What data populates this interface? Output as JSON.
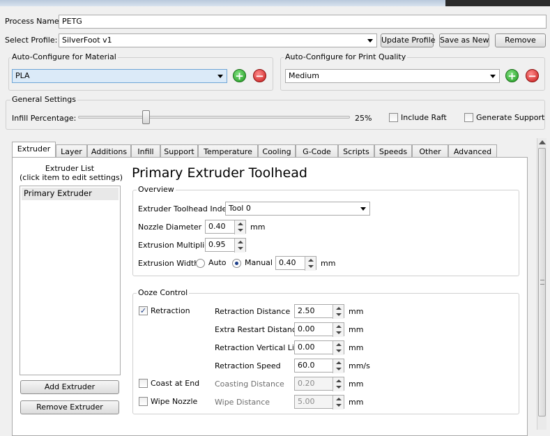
{
  "window": {
    "title": ""
  },
  "process": {
    "name_label": "Process Name:",
    "name_value": "PETG"
  },
  "profile": {
    "label": "Select Profile:",
    "selected": "SilverFoot v1",
    "update_button": "Update Profile",
    "save_as_new_button": "Save as New",
    "remove_button": "Remove"
  },
  "material": {
    "group_label": "Auto-Configure for Material",
    "selected": "PLA",
    "add_symbol": "+",
    "remove_symbol": "−"
  },
  "quality": {
    "group_label": "Auto-Configure for Print Quality",
    "selected": "Medium",
    "add_symbol": "+",
    "remove_symbol": "−"
  },
  "general": {
    "group_label": "General Settings",
    "infill_label": "Infill Percentage:",
    "infill_value_text": "25%",
    "infill_fraction": 0.25,
    "include_raft_label": "Include Raft",
    "include_raft_checked": false,
    "generate_support_label": "Generate Support",
    "generate_support_checked": false
  },
  "tabs": [
    {
      "label": "Extruder",
      "active": true
    },
    {
      "label": "Layer"
    },
    {
      "label": "Additions"
    },
    {
      "label": "Infill"
    },
    {
      "label": "Support"
    },
    {
      "label": "Temperature"
    },
    {
      "label": "Cooling"
    },
    {
      "label": "G-Code"
    },
    {
      "label": "Scripts"
    },
    {
      "label": "Speeds"
    },
    {
      "label": "Other"
    },
    {
      "label": "Advanced"
    }
  ],
  "extruder_list": {
    "title_line1": "Extruder List",
    "title_line2": "(click item to edit settings)",
    "items": [
      "Primary Extruder"
    ],
    "add_button": "Add Extruder",
    "remove_button": "Remove Extruder"
  },
  "toolhead": {
    "heading": "Primary Extruder Toolhead",
    "overview_label": "Overview",
    "index_label": "Extruder Toolhead Index",
    "index_value": "Tool 0",
    "nozzle_label": "Nozzle Diameter",
    "nozzle_value": "0.40",
    "nozzle_unit": "mm",
    "multiplier_label": "Extrusion Multiplier",
    "multiplier_value": "0.95",
    "width_label": "Extrusion Width",
    "width_auto_label": "Auto",
    "width_manual_label": "Manual",
    "width_mode": "Manual",
    "width_value": "0.40",
    "width_unit": "mm"
  },
  "ooze": {
    "group_label": "Ooze Control",
    "retraction_label": "Retraction",
    "retraction_checked": true,
    "coast_label": "Coast at End",
    "coast_checked": false,
    "wipe_label": "Wipe Nozzle",
    "wipe_checked": false,
    "check_mark": "✓",
    "rows": [
      {
        "label": "Retraction Distance",
        "value": "2.50",
        "unit": "mm",
        "disabled": false
      },
      {
        "label": "Extra Restart Distance",
        "value": "0.00",
        "unit": "mm",
        "disabled": false
      },
      {
        "label": "Retraction Vertical Lift",
        "value": "0.00",
        "unit": "mm",
        "disabled": false
      },
      {
        "label": "Retraction Speed",
        "value": "60.0",
        "unit": "mm/s",
        "disabled": false
      },
      {
        "label": "Coasting Distance",
        "value": "0.20",
        "unit": "mm",
        "disabled": true
      },
      {
        "label": "Wipe Distance",
        "value": "5.00",
        "unit": "mm",
        "disabled": true
      }
    ]
  }
}
